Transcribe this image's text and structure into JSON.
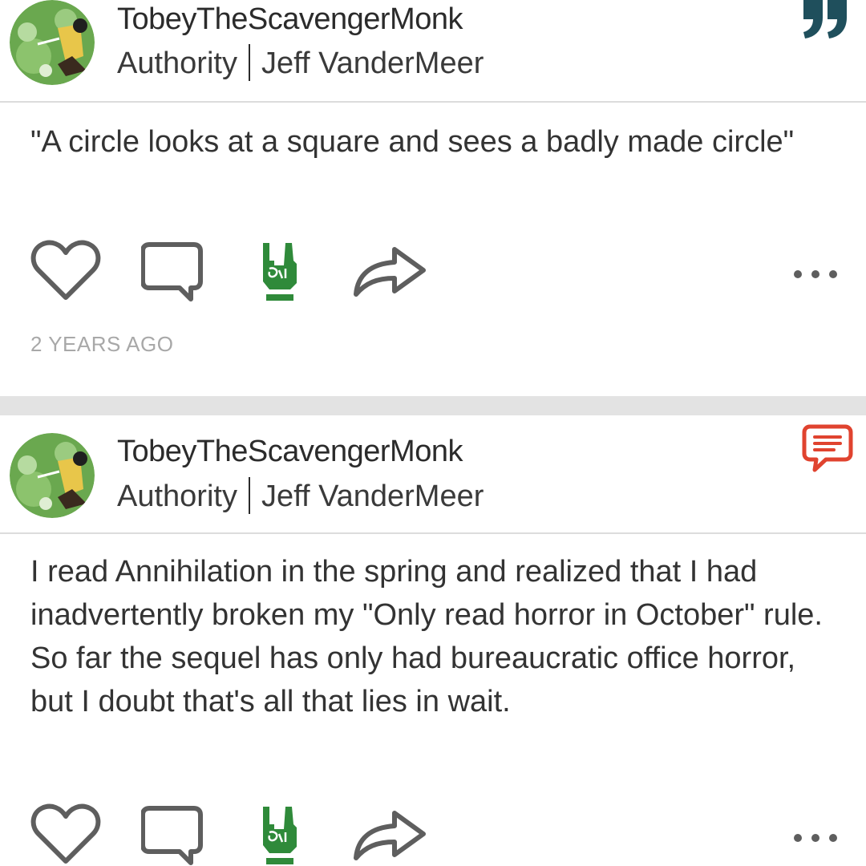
{
  "posts": [
    {
      "username": "TobeyTheScavengerMonk",
      "book_title": "Authority",
      "author": "Jeff VanderMeer",
      "badge_icon": "quote-icon",
      "text": "\"A circle looks at a square and sees a badly made circle\"",
      "timestamp": "2 YEARS AGO"
    },
    {
      "username": "TobeyTheScavengerMonk",
      "book_title": "Authority",
      "author": "Jeff VanderMeer",
      "badge_icon": "comment-badge-icon",
      "text": "I read Annihilation in the spring and realized that I had inadvertently broken my \"Only read horror in October\" rule. So far the sequel has only had bureaucratic office horror, but I doubt that's all that lies in wait."
    }
  ],
  "icons": {
    "like": "heart-icon",
    "comment": "comment-icon",
    "horns": "rock-horns-icon",
    "share": "share-arrow-icon",
    "more": "more-dots-icon"
  },
  "colors": {
    "quote_badge": "#1f4f5c",
    "comment_badge": "#e0432f",
    "horns_green": "#2f8a3a",
    "icon_gray": "#5e5e5e",
    "timestamp_gray": "#a8a8a8",
    "separator": "#e3e3e3"
  }
}
